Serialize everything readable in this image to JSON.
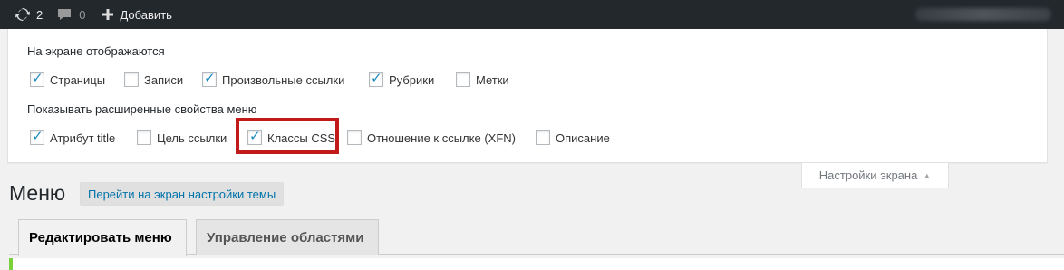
{
  "adminbar": {
    "updates_count": "2",
    "comments_count": "0",
    "new_label": "Добавить"
  },
  "screen_options": {
    "boxes_legend": "На экране отображаются",
    "boxes": [
      {
        "label": "Страницы",
        "checked": true
      },
      {
        "label": "Записи",
        "checked": false
      },
      {
        "label": "Произвольные ссылки",
        "checked": true
      },
      {
        "label": "Рубрики",
        "checked": true
      },
      {
        "label": "Метки",
        "checked": false
      }
    ],
    "advanced_legend": "Показывать расширенные свойства меню",
    "advanced": [
      {
        "label": "Атрибут title",
        "checked": true
      },
      {
        "label": "Цель ссылки",
        "checked": false
      },
      {
        "label": "Классы CSS",
        "checked": true
      },
      {
        "label": "Отношение к ссылке (XFN)",
        "checked": false
      },
      {
        "label": "Описание",
        "checked": false
      }
    ],
    "tab_label": "Настройки экрана",
    "tab_arrow": "▲"
  },
  "page": {
    "title": "Меню",
    "action_label": "Перейти на экран настройки темы"
  },
  "nav_tabs": [
    {
      "label": "Редактировать меню",
      "active": true
    },
    {
      "label": "Управление областями",
      "active": false
    }
  ],
  "tick_glyph": "✓",
  "colors": {
    "adminbar_bg": "#23282d",
    "highlight": "#c11a1a",
    "link": "#0073aa",
    "checkmark": "#1e8cbe",
    "menu_accent": "#7ad03a"
  }
}
